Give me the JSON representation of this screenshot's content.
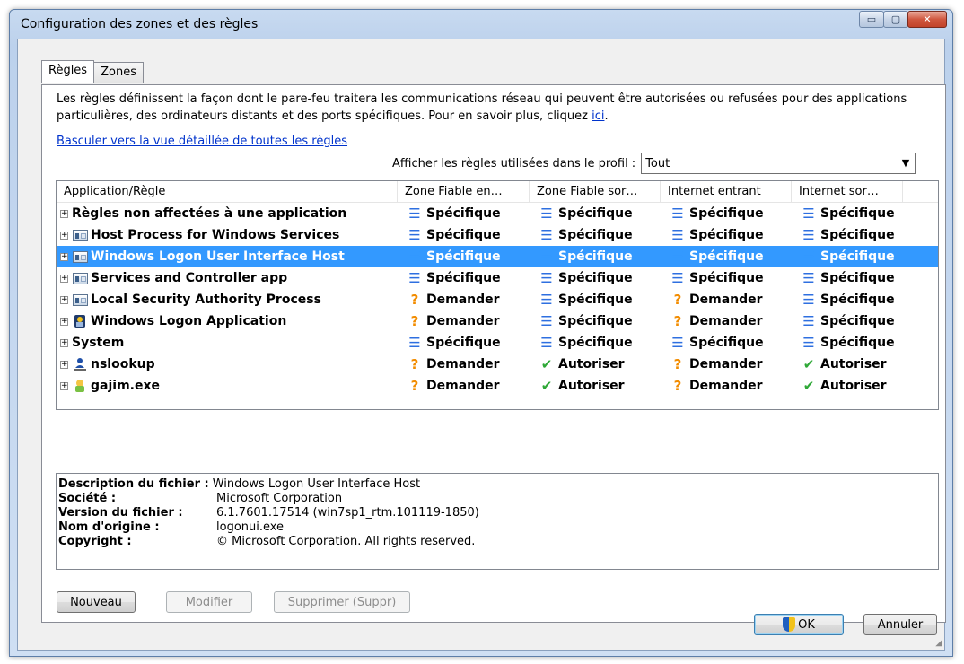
{
  "window": {
    "title": "Configuration des zones et des règles",
    "min": "▭",
    "max": "▢",
    "close": "✕"
  },
  "tabs": [
    {
      "label": "Règles",
      "active": true
    },
    {
      "label": "Zones",
      "active": false
    }
  ],
  "description": {
    "text": "Les règles définissent la façon dont le pare-feu traitera les communications réseau qui peuvent être autorisées ou refusées pour des applications particulières, des ordinateurs distants et des ports spécifiques. Pour en savoir plus, cliquez ",
    "link": "ici",
    "end": "."
  },
  "switch_link": "Basculer vers la vue détaillée de toutes les règles",
  "profile": {
    "label": "Afficher les règles utilisées dans le profil :",
    "value": "Tout"
  },
  "columns": [
    "Application/Règle",
    "Zone Fiable en…",
    "Zone Fiable sor…",
    "Internet entrant",
    "Internet sor…"
  ],
  "rows": [
    {
      "name": "Règles non affectées à une application",
      "icon": "none",
      "selected": false,
      "cells": [
        [
          "spec",
          "Spécifique"
        ],
        [
          "spec",
          "Spécifique"
        ],
        [
          "spec",
          "Spécifique"
        ],
        [
          "spec",
          "Spécifique"
        ]
      ]
    },
    {
      "name": "Host Process for Windows Services",
      "icon": "window-app-icon",
      "selected": false,
      "cells": [
        [
          "spec",
          "Spécifique"
        ],
        [
          "spec",
          "Spécifique"
        ],
        [
          "spec",
          "Spécifique"
        ],
        [
          "spec",
          "Spécifique"
        ]
      ]
    },
    {
      "name": "Windows Logon User Interface Host",
      "icon": "window-app-icon",
      "selected": true,
      "cells": [
        [
          "spec",
          "Spécifique"
        ],
        [
          "spec",
          "Spécifique"
        ],
        [
          "spec",
          "Spécifique"
        ],
        [
          "spec",
          "Spécifique"
        ]
      ]
    },
    {
      "name": "Services and Controller app",
      "icon": "window-app-icon",
      "selected": false,
      "cells": [
        [
          "spec",
          "Spécifique"
        ],
        [
          "spec",
          "Spécifique"
        ],
        [
          "spec",
          "Spécifique"
        ],
        [
          "spec",
          "Spécifique"
        ]
      ]
    },
    {
      "name": "Local Security Authority Process",
      "icon": "window-app-icon",
      "selected": false,
      "cells": [
        [
          "ask",
          "Demander"
        ],
        [
          "spec",
          "Spécifique"
        ],
        [
          "ask",
          "Demander"
        ],
        [
          "spec",
          "Spécifique"
        ]
      ]
    },
    {
      "name": "Windows Logon Application",
      "icon": "logon-app-icon",
      "selected": false,
      "cells": [
        [
          "ask",
          "Demander"
        ],
        [
          "spec",
          "Spécifique"
        ],
        [
          "ask",
          "Demander"
        ],
        [
          "spec",
          "Spécifique"
        ]
      ]
    },
    {
      "name": "System",
      "icon": "none",
      "selected": false,
      "cells": [
        [
          "spec",
          "Spécifique"
        ],
        [
          "spec",
          "Spécifique"
        ],
        [
          "spec",
          "Spécifique"
        ],
        [
          "spec",
          "Spécifique"
        ]
      ]
    },
    {
      "name": "nslookup",
      "icon": "user-network-icon",
      "selected": false,
      "cells": [
        [
          "ask",
          "Demander"
        ],
        [
          "allow",
          "Autoriser"
        ],
        [
          "ask",
          "Demander"
        ],
        [
          "allow",
          "Autoriser"
        ]
      ]
    },
    {
      "name": "gajim.exe",
      "icon": "gajim-icon",
      "selected": false,
      "cells": [
        [
          "ask",
          "Demander"
        ],
        [
          "allow",
          "Autoriser"
        ],
        [
          "ask",
          "Demander"
        ],
        [
          "allow",
          "Autoriser"
        ]
      ]
    }
  ],
  "status_glyphs": {
    "spec": "☰",
    "ask": "?",
    "allow": "✔"
  },
  "details": [
    {
      "label": "Description du fichier :",
      "value": "Windows Logon User Interface Host"
    },
    {
      "label": "Société :",
      "value": "Microsoft Corporation"
    },
    {
      "label": "Version du fichier :",
      "value": "6.1.7601.17514 (win7sp1_rtm.101119-1850)"
    },
    {
      "label": "Nom d'origine :",
      "value": "logonui.exe"
    },
    {
      "label": "Copyright :",
      "value": "© Microsoft Corporation. All rights reserved."
    }
  ],
  "buttons": {
    "new": "Nouveau",
    "edit": "Modifier",
    "delete": "Supprimer (Suppr)",
    "ok": "OK",
    "cancel": "Annuler"
  },
  "colors": {
    "selection": "#3399ff",
    "specific": "#2e6fe0",
    "ask": "#f28c00",
    "allow": "#2ea836"
  }
}
